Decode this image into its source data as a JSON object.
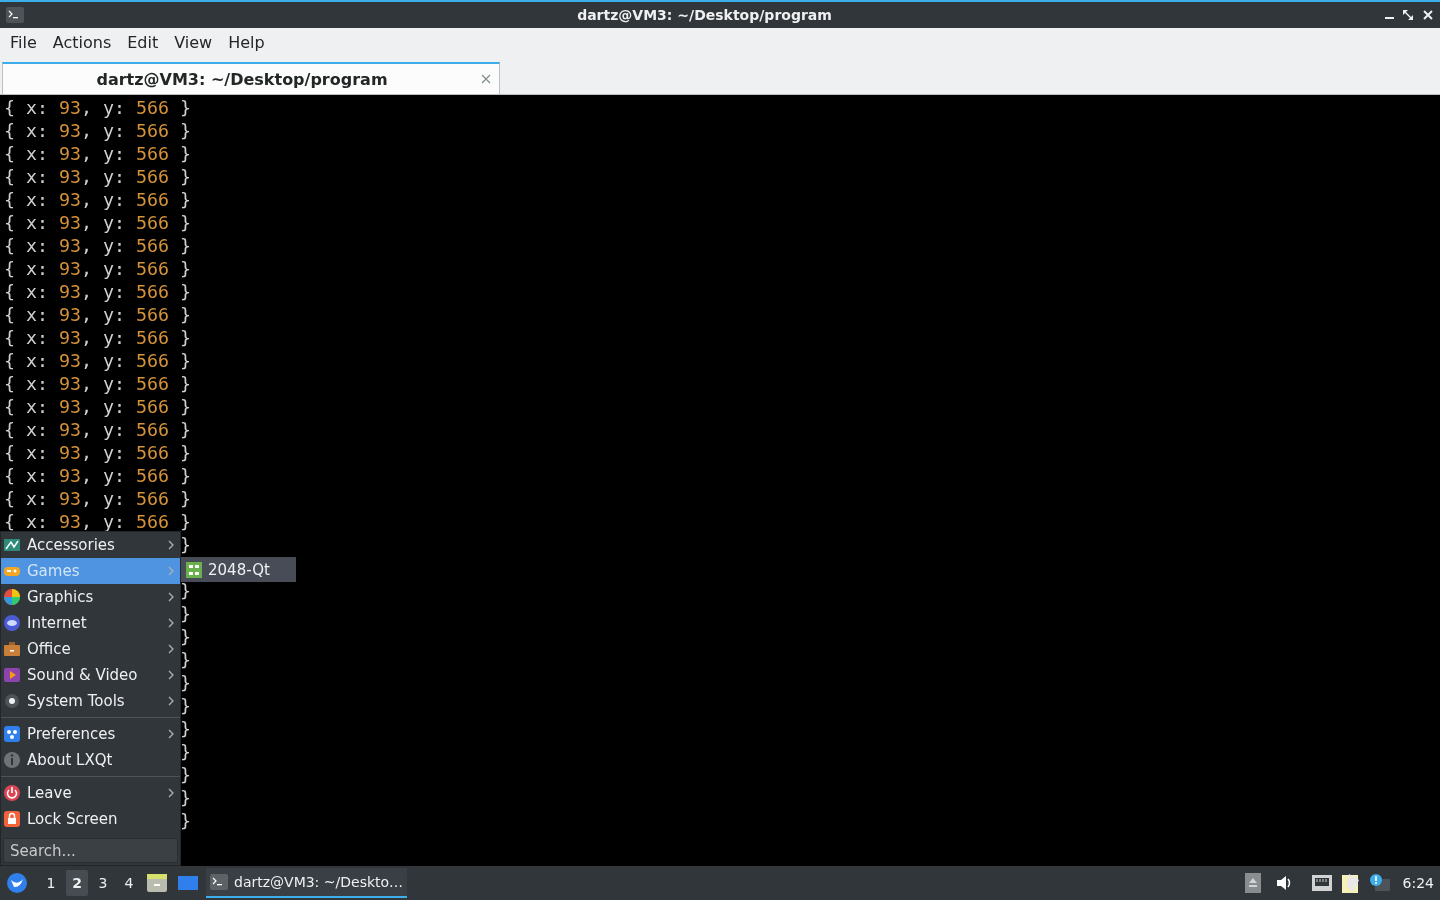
{
  "window": {
    "title": "dartz@VM3: ~/Desktop/program"
  },
  "menu_bar": [
    "File",
    "Actions",
    "Edit",
    "View",
    "Help"
  ],
  "tabs": [
    {
      "label": "dartz@VM3: ~/Desktop/program",
      "selected": true
    }
  ],
  "terminal": {
    "lines": [
      {
        "kind": "full",
        "text": "{ x: 93, y: 566 }"
      },
      {
        "kind": "full",
        "text": "{ x: 93, y: 566 }"
      },
      {
        "kind": "full",
        "text": "{ x: 93, y: 566 }"
      },
      {
        "kind": "full",
        "text": "{ x: 93, y: 566 }"
      },
      {
        "kind": "full",
        "text": "{ x: 93, y: 566 }"
      },
      {
        "kind": "full",
        "text": "{ x: 93, y: 566 }"
      },
      {
        "kind": "full",
        "text": "{ x: 93, y: 566 }"
      },
      {
        "kind": "full",
        "text": "{ x: 93, y: 566 }"
      },
      {
        "kind": "full",
        "text": "{ x: 93, y: 566 }"
      },
      {
        "kind": "full",
        "text": "{ x: 93, y: 566 }"
      },
      {
        "kind": "full",
        "text": "{ x: 93, y: 566 }"
      },
      {
        "kind": "full",
        "text": "{ x: 93, y: 566 }"
      },
      {
        "kind": "full",
        "text": "{ x: 93, y: 566 }"
      },
      {
        "kind": "full",
        "text": "{ x: 93, y: 566 }"
      },
      {
        "kind": "full",
        "text": "{ x: 93, y: 566 }"
      },
      {
        "kind": "full",
        "text": "{ x: 93, y: 566 }"
      },
      {
        "kind": "full",
        "text": "{ x: 93, y: 566 }"
      },
      {
        "kind": "full",
        "text": "{ x: 93, y: 566 }"
      },
      {
        "kind": "full",
        "text": "{ x: 93, y: 566 }"
      },
      {
        "kind": "covered",
        "text": "}"
      }
    ],
    "lines_below_submenu": [
      {
        "kind": "covered",
        "text": "}"
      },
      {
        "kind": "covered",
        "text": "}"
      },
      {
        "kind": "covered",
        "text": "}"
      },
      {
        "kind": "covered",
        "text": "}"
      },
      {
        "kind": "covered",
        "text": "}"
      },
      {
        "kind": "covered",
        "text": "}"
      },
      {
        "kind": "covered",
        "text": "}"
      },
      {
        "kind": "covered",
        "text": "}"
      },
      {
        "kind": "covered",
        "text": "}"
      },
      {
        "kind": "covered",
        "text": "}"
      },
      {
        "kind": "covered",
        "text": "}"
      }
    ]
  },
  "app_menu": {
    "sections": [
      [
        {
          "label": "Accessories",
          "submenu": true,
          "selected": false
        },
        {
          "label": "Games",
          "submenu": true,
          "selected": true
        },
        {
          "label": "Graphics",
          "submenu": true,
          "selected": false
        },
        {
          "label": "Internet",
          "submenu": true,
          "selected": false
        },
        {
          "label": "Office",
          "submenu": true,
          "selected": false
        },
        {
          "label": "Sound & Video",
          "submenu": true,
          "selected": false
        },
        {
          "label": "System Tools",
          "submenu": true,
          "selected": false
        }
      ],
      [
        {
          "label": "Preferences",
          "submenu": true,
          "selected": false
        },
        {
          "label": "About LXQt",
          "submenu": false,
          "selected": false
        }
      ],
      [
        {
          "label": "Leave",
          "submenu": true,
          "selected": false
        },
        {
          "label": "Lock Screen",
          "submenu": false,
          "selected": false
        }
      ]
    ],
    "search": {
      "placeholder": "Search..."
    },
    "submenu": [
      {
        "label": "2048-Qt"
      }
    ]
  },
  "taskbar": {
    "desktops": [
      {
        "label": "1",
        "selected": false
      },
      {
        "label": "2",
        "selected": true
      },
      {
        "label": "3",
        "selected": false
      },
      {
        "label": "4",
        "selected": false
      }
    ],
    "tasks": [
      {
        "label": "dartz@VM3: ~/Deskto…",
        "selected": true
      }
    ],
    "clock": "6:24"
  }
}
